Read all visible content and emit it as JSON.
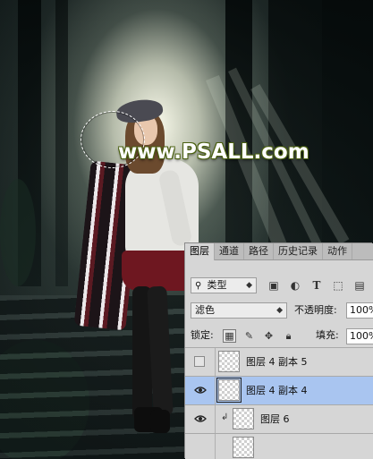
{
  "watermark": "www.PSALL.com",
  "panel": {
    "tabs": [
      "图层",
      "通道",
      "路径",
      "历史记录",
      "动作"
    ],
    "active_tab": "图层",
    "filter": {
      "label": "类型",
      "icon": "search-icon"
    },
    "blend_mode": "滤色",
    "opacity": {
      "label": "不透明度:",
      "value": "100%"
    },
    "lock": {
      "label": "锁定:"
    },
    "fill": {
      "label": "填充:",
      "value": "100%"
    },
    "layers": [
      {
        "name": "图层 4 副本 5",
        "visible": false,
        "selected": false,
        "clipped": false
      },
      {
        "name": "图层 4 副本 4",
        "visible": true,
        "selected": true,
        "clipped": false
      },
      {
        "name": "图层 6",
        "visible": true,
        "selected": false,
        "clipped": true
      }
    ]
  },
  "colors": {
    "panel_bg": "#d6d6d6",
    "selected_layer": "#a9c5f0",
    "watermark_outline": "#4a6010"
  }
}
